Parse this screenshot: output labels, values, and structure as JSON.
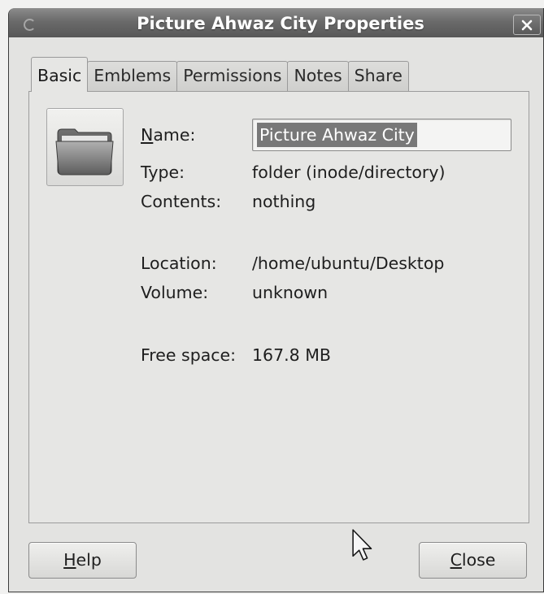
{
  "window": {
    "title": "Picture Ahwaz City Properties"
  },
  "tabs": [
    {
      "label": "Basic",
      "active": true
    },
    {
      "label": "Emblems",
      "active": false
    },
    {
      "label": "Permissions",
      "active": false
    },
    {
      "label": "Notes",
      "active": false
    },
    {
      "label": "Share",
      "active": false
    }
  ],
  "basic": {
    "name": {
      "label": "Name:",
      "value": "Picture Ahwaz City",
      "selected": true
    },
    "type": {
      "label": "Type:",
      "value": "folder (inode/directory)"
    },
    "contents": {
      "label": "Contents:",
      "value": "nothing"
    },
    "location": {
      "label": "Location:",
      "value": "/home/ubuntu/Desktop"
    },
    "volume": {
      "label": "Volume:",
      "value": "unknown"
    },
    "free_space": {
      "label": "Free space:",
      "value": "167.8 MB"
    }
  },
  "buttons": {
    "help": "Help",
    "close": "Close"
  },
  "icons": {
    "window_menu": "window-menu-icon",
    "close": "close-icon",
    "folder": "folder-icon",
    "pointer": "mouse-pointer-icon"
  },
  "colors": {
    "title_bar": "#6a6a6a",
    "title_text": "#ffffff",
    "selection": "#787878",
    "window_background": "#e3e3e1"
  }
}
